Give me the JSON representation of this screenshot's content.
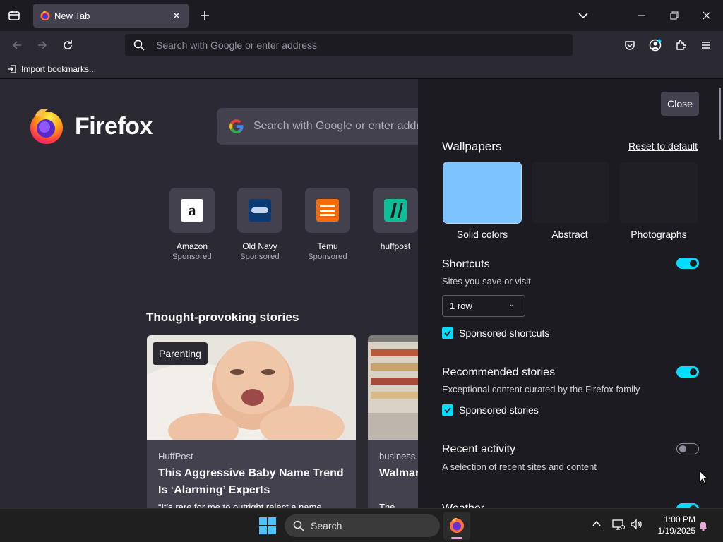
{
  "colors": {
    "accent": "#00ddff",
    "panel_bg": "#1c1b22",
    "content_bg": "#2b2a33",
    "tile_bg": "#42414d",
    "solid_color_swatch": "#7cc3ff"
  },
  "tabstrip": {
    "tab": {
      "title": "New Tab",
      "favicon": "firefox-icon",
      "close_icon": "close-icon"
    },
    "new_tab_icon": "plus-icon",
    "list_tabs_icon": "chevron-down-icon",
    "window_controls": [
      "minimize-icon",
      "restore-icon",
      "close-icon"
    ]
  },
  "navbar": {
    "url_placeholder": "Search with Google or enter address",
    "icons": [
      "back-icon",
      "forward-icon",
      "reload-icon",
      "pocket-icon",
      "account-icon",
      "extensions-icon",
      "menu-icon"
    ]
  },
  "bookmarks": {
    "import_label": "Import bookmarks..."
  },
  "newtab": {
    "brand": "Firefox",
    "search_placeholder": "Search with Google or enter address",
    "shortcuts": [
      {
        "name": "Amazon",
        "sponsored": "Sponsored",
        "icon": "amazon-icon"
      },
      {
        "name": "Old Navy",
        "sponsored": "Sponsored",
        "icon": "old-navy-icon"
      },
      {
        "name": "Temu",
        "sponsored": "Sponsored",
        "icon": "temu-icon"
      },
      {
        "name": "huffpost",
        "sponsored": "",
        "icon": "huffpost-icon"
      }
    ],
    "stories_heading": "Thought-provoking stories",
    "stories": [
      {
        "badge": "Parenting",
        "source": "HuffPost",
        "headline": "This Aggressive Baby Name Trend Is ‘Alarming’ Experts",
        "excerpt": "“It’s rare for me to outright reject a name"
      },
      {
        "badge": "",
        "source": "business.c",
        "headline": "Walmar",
        "excerpt": "The seaso everythin"
      }
    ]
  },
  "customize": {
    "close_label": "Close",
    "wallpapers_heading": "Wallpapers",
    "reset_label": "Reset to default",
    "wallpapers": [
      {
        "label": "Solid colors"
      },
      {
        "label": "Abstract"
      },
      {
        "label": "Photographs"
      }
    ],
    "shortcuts": {
      "heading": "Shortcuts",
      "subtitle": "Sites you save or visit",
      "enabled": true,
      "rows_value": "1 row",
      "sponsored_label": "Sponsored shortcuts",
      "sponsored_checked": true
    },
    "stories": {
      "heading": "Recommended stories",
      "subtitle": "Exceptional content curated by the Firefox family",
      "enabled": true,
      "sponsored_label": "Sponsored stories",
      "sponsored_checked": true
    },
    "recent": {
      "heading": "Recent activity",
      "subtitle": "A selection of recent sites and content",
      "enabled": false
    },
    "weather": {
      "heading": "Weather",
      "enabled": true
    }
  },
  "taskbar": {
    "search_label": "Search",
    "time": "1:00 PM",
    "date": "1/19/2025",
    "tray_icons": [
      "chevron-up-icon",
      "network-icon",
      "volume-icon",
      "notification-bell-icon"
    ]
  }
}
